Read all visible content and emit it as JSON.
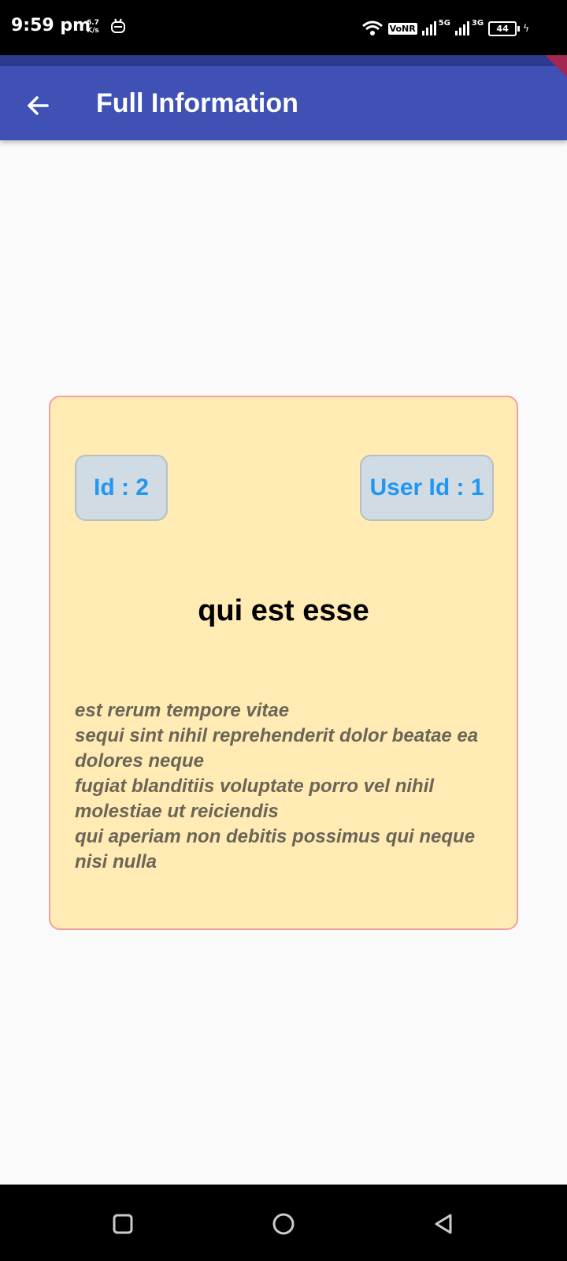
{
  "status_bar": {
    "time": "9:59 pm",
    "speed_value": "6.7",
    "speed_unit": "K/s",
    "vonr": "VoNR",
    "net1": "5G",
    "net2": "3G",
    "battery": "44"
  },
  "app_bar": {
    "title": "Full Information",
    "color": "#3f51b5"
  },
  "post": {
    "id_label": "Id  : 2",
    "user_id_label": "User Id  : 1",
    "title": "qui est esse",
    "body": "est rerum tempore vitae\nsequi sint nihil reprehenderit dolor beatae ea dolores neque\nfugiat blanditiis voluptate porro vel nihil molestiae ut reiciendis\nqui aperiam non debitis possimus qui neque nisi nulla",
    "card_color": "#ffebb3",
    "chip_text_color": "#2196f3"
  },
  "nav_bar": {
    "icons": [
      "recents-square-icon",
      "home-circle-icon",
      "back-triangle-icon"
    ]
  }
}
